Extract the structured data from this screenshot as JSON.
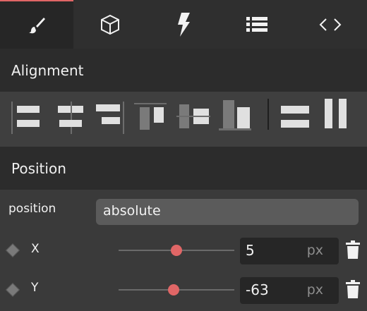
{
  "tabs": [
    {
      "icon": "brush-icon",
      "active": true
    },
    {
      "icon": "cube-icon",
      "active": false
    },
    {
      "icon": "lightning-icon",
      "active": false
    },
    {
      "icon": "list-icon",
      "active": false
    },
    {
      "icon": "code-icon",
      "active": false
    }
  ],
  "alignment": {
    "title": "Alignment",
    "buttons": [
      "align-left-icon",
      "align-center-horizontal-icon",
      "align-right-icon",
      "align-top-icon",
      "align-middle-vertical-icon",
      "align-bottom-icon",
      "distribute-vertical-icon",
      "distribute-horizontal-icon"
    ]
  },
  "position": {
    "title": "Position",
    "position_label": "position",
    "position_value": "absolute",
    "x": {
      "label": "X",
      "value": "5",
      "unit": "px"
    },
    "y": {
      "label": "Y",
      "value": "-63",
      "unit": "px"
    }
  },
  "colors": {
    "accent": "#e06666",
    "panel": "#3a3a3a",
    "header": "#2c2c2c"
  }
}
